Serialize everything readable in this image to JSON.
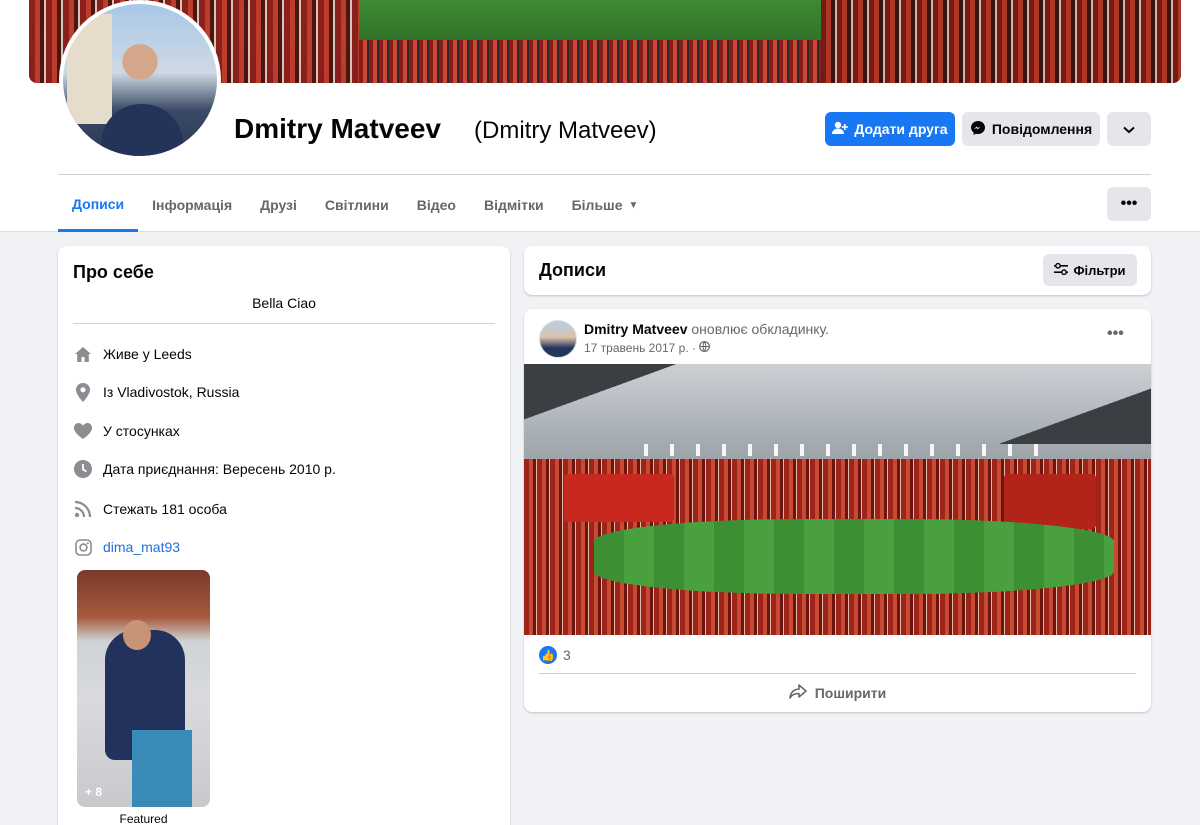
{
  "profile": {
    "name": "Dmitry Matveev",
    "alternate_name": "(Dmitry Matveev)"
  },
  "actions": {
    "add_friend": "Додати друга",
    "message": "Повідомлення",
    "more_icon": "chevron-down-icon",
    "dots_icon": "more-dots-icon"
  },
  "tabs": [
    {
      "label": "Дописи",
      "active": true
    },
    {
      "label": "Інформація"
    },
    {
      "label": "Друзі"
    },
    {
      "label": "Світлини"
    },
    {
      "label": "Відео"
    },
    {
      "label": "Відмітки"
    },
    {
      "label": "Більше"
    }
  ],
  "about": {
    "title": "Про себе",
    "bio": "Bella Ciao",
    "items": [
      {
        "icon": "home-icon",
        "text": "Живе у Leeds"
      },
      {
        "icon": "location-pin-icon",
        "text": "Із Vladivostok, Russia"
      },
      {
        "icon": "heart-icon",
        "text": "У стосунках"
      },
      {
        "icon": "clock-icon",
        "text": "Дата приєднання: Вересень 2010 р."
      },
      {
        "icon": "rss-icon",
        "text": "Стежать 181 особа"
      },
      {
        "icon": "instagram-icon",
        "text": "dima_mat93"
      }
    ],
    "featured_more": "+ 8",
    "featured_label": "Featured"
  },
  "posts": {
    "title": "Дописи",
    "filter": "Фільтри"
  },
  "post": {
    "author": "Dmitry Matveev",
    "action": "оновлює обкладинку.",
    "date": "17 травень 2017 р. ·",
    "likes": "3",
    "share": "Поширити"
  },
  "colors": {
    "accent": "#1877f2",
    "background": "#f0f2f5",
    "secondary_button": "#e4e6eb"
  }
}
